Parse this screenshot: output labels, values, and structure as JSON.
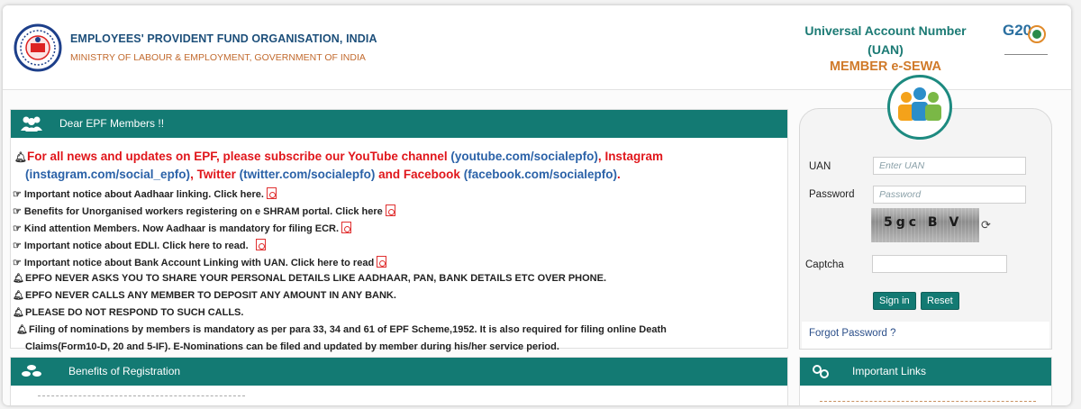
{
  "header": {
    "org_name": "EMPLOYEES' PROVIDENT FUND ORGANISATION, INDIA",
    "ministry": "MINISTRY OF LABOUR & EMPLOYMENT, GOVERNMENT OF INDIA",
    "uan_line1": "Universal Account Number",
    "uan_line2": "(UAN)",
    "member_esewa": "MEMBER e-SEWA",
    "g20": "G20"
  },
  "news": {
    "title": "Dear EPF Members !!",
    "subscribe_pre": "For all news and updates on EPF, please subscribe our YouTube channel",
    "youtube": "(youtube.com/socialepfo)",
    "comma1": ",",
    "instagram_label": "Instagram",
    "instagram": "(instagram.com/social_epfo)",
    "comma2": ",",
    "twitter_label": "Twitter",
    "twitter": "(twitter.com/socialepfo)",
    "and_fb": "and Facebook",
    "facebook": "(facebook.com/socialepfo)",
    "period": ".",
    "items": [
      "Important notice about Aadhaar linking. Click here.",
      "Benefits for Unorganised workers registering on e SHRAM portal. Click here",
      "Kind attention Members. Now Aadhaar is mandatory for filing ECR.",
      "Important notice about EDLI. Click here to read.",
      "Important notice about Bank Account Linking with UAN. Click here to read"
    ],
    "warnings": [
      "EPFO NEVER ASKS YOU TO SHARE YOUR PERSONAL DETAILS LIKE AADHAAR, PAN, BANK DETAILS ETC OVER PHONE.",
      "EPFO NEVER CALLS ANY MEMBER TO DEPOSIT ANY AMOUNT IN ANY BANK.",
      "PLEASE DO NOT RESPOND TO SUCH CALLS."
    ],
    "nomination_line1": "Filing of nominations by members is mandatory as per para 33, 34 and 61 of EPF Scheme,1952. It is also required for filing online Death",
    "nomination_line2": "Claims(Form10-D, 20 and 5-IF). E-Nominations can be filed and updated by member during his/her service period."
  },
  "benefits": {
    "title": "Benefits of Registration"
  },
  "login": {
    "uan_label": "UAN",
    "uan_placeholder": "Enter UAN",
    "password_label": "Password",
    "password_placeholder": "Password",
    "captcha_text": "5gc B V",
    "captcha_label": "Captcha",
    "signin_label": "Sign in",
    "reset_label": "Reset",
    "forgot_label": "Forgot Password ?"
  },
  "links": {
    "title": "Important Links"
  },
  "colors": {
    "teal": "#137a73",
    "red": "#e0161b",
    "link_blue": "#2b62a8",
    "orange": "#d07a2a"
  }
}
